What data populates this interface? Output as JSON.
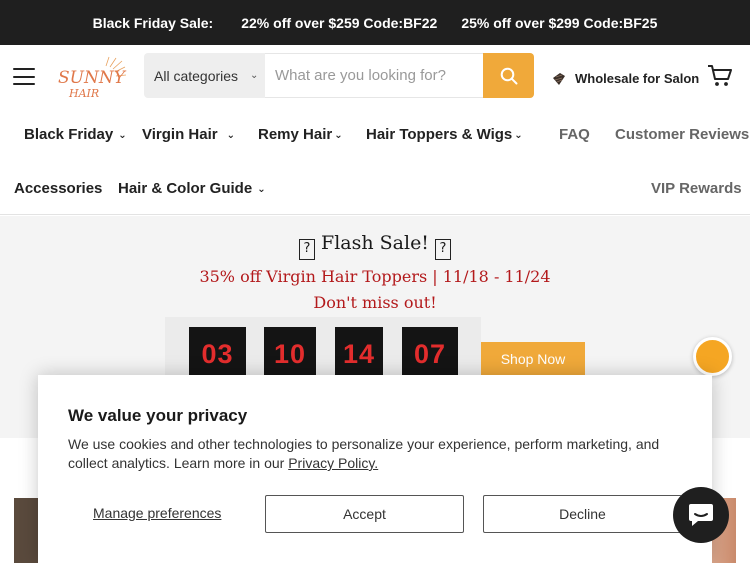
{
  "announcement": {
    "label": "Black Friday Sale:",
    "offer1": "22% off over $259 Code:BF22",
    "offer2": "25% off over $299 Code:BF25"
  },
  "header": {
    "logo_text_1": "SUNNY",
    "logo_text_2": "HAIR",
    "search": {
      "category": "All categories",
      "placeholder": "What are you looking for?"
    },
    "wholesale_label": "Wholesale for Salon"
  },
  "nav": {
    "row1": [
      {
        "label": "Black Friday"
      },
      {
        "label": "Virgin Hair"
      },
      {
        "label": "Remy Hair"
      },
      {
        "label": "Hair Toppers & Wigs"
      },
      {
        "label": "FAQ"
      },
      {
        "label": "Customer Reviews"
      }
    ],
    "row2": [
      {
        "label": "Accessories"
      },
      {
        "label": "Hair & Color Guide"
      },
      {
        "label": "VIP Rewards"
      }
    ]
  },
  "flash": {
    "title": "Flash Sale!",
    "glyph": "?",
    "subtitle": "35% off Virgin Hair Toppers | 11/18 - 11/24",
    "subtitle2": "Don't miss out!",
    "countdown": [
      "03",
      "10",
      "14",
      "07"
    ],
    "cta": "Shop Now"
  },
  "cookie": {
    "title": "We value your privacy",
    "text": "We use cookies and other technologies to personalize your experience, perform marketing, and collect analytics. Learn more in our ",
    "link": "Privacy Policy.",
    "manage": "Manage preferences",
    "accept": "Accept",
    "decline": "Decline"
  },
  "colors": {
    "accent": "#f0a93a",
    "sale_red": "#b3191b",
    "countdown_red": "#e32d2d",
    "dark": "#1f1f1f"
  }
}
